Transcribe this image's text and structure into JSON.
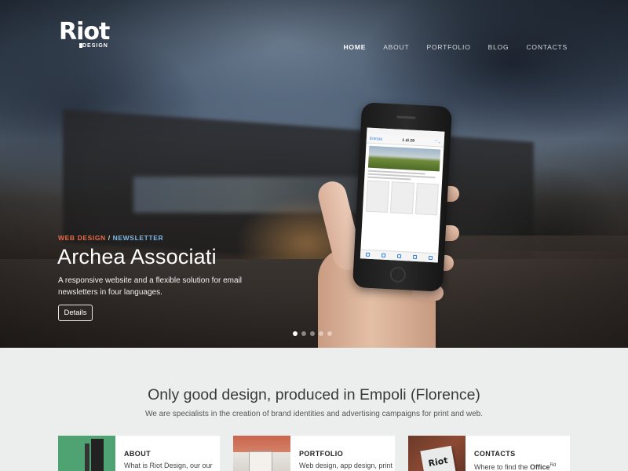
{
  "brand": {
    "logo_text": "Riot",
    "logo_sub": "DESIGN"
  },
  "nav": {
    "items": [
      {
        "label": "HOME",
        "active": true
      },
      {
        "label": "ABOUT",
        "active": false
      },
      {
        "label": "PORTFOLIO",
        "active": false
      },
      {
        "label": "BLOG",
        "active": false
      },
      {
        "label": "CONTACTS",
        "active": false
      }
    ]
  },
  "hero": {
    "category_1": "WEB DESIGN",
    "category_sep": " / ",
    "category_2": "NEWSLETTER",
    "title": "Archea Associati",
    "description": "A responsive website and a flexible solution for email newsletters in four languages.",
    "button_label": "Details",
    "slides": 5,
    "active_slide": 1
  },
  "phone_screen": {
    "back_label": "Entrata",
    "page_count": "1 di 28"
  },
  "intro": {
    "tagline": "Only good design, produced in Empoli (Florence)",
    "subline": "We are specialists in the creation of brand identities and advertising campaigns for print and web."
  },
  "cards": [
    {
      "title": "ABOUT",
      "desc": "What is Riot Design, our our"
    },
    {
      "title": "PORTFOLIO",
      "desc": "Web design, app design, print"
    },
    {
      "title": "CONTACTS",
      "desc_prefix": "Where to find the ",
      "desc_bold": "Office",
      "desc_sup": "Rd"
    }
  ],
  "colors": {
    "category_1": "#e96b4a",
    "category_2": "#7fb8e3",
    "page_background": "#eceeed"
  }
}
